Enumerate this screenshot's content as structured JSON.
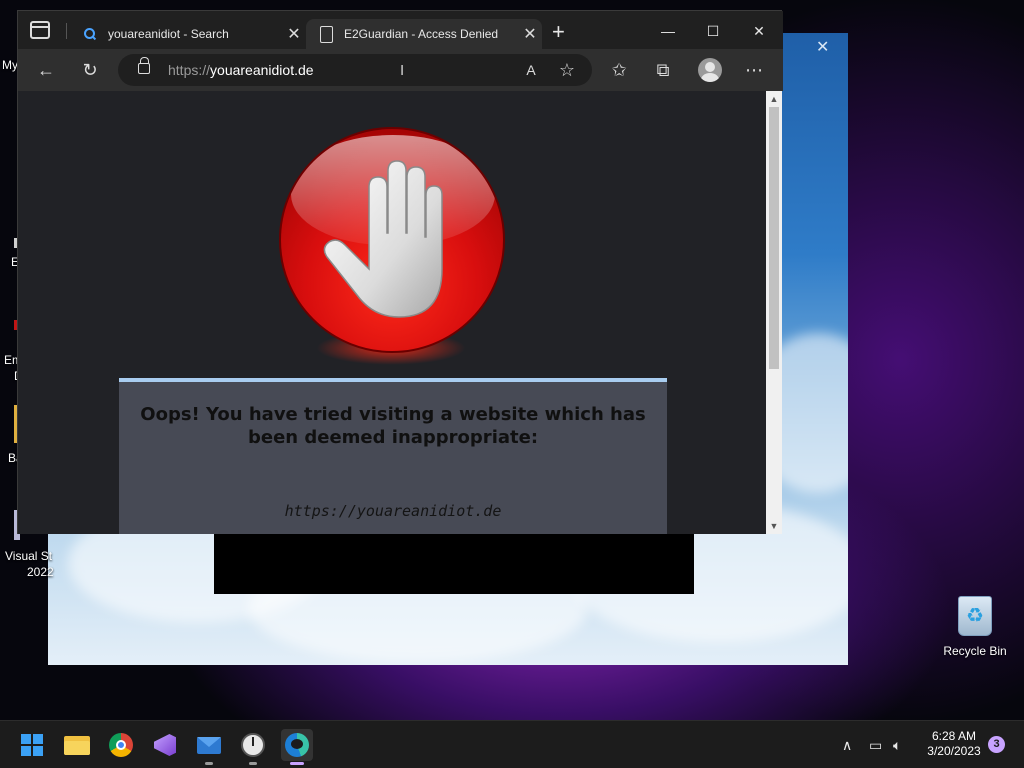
{
  "desktop": {
    "icon_fragments": [
      "My",
      "E",
      "Em",
      "D",
      "Ba",
      "Visual St",
      "2022"
    ],
    "recycle_bin_label": "Recycle Bin",
    "background_close": "✕"
  },
  "browser": {
    "tabs": [
      {
        "title": "youareanidiot - Search",
        "icon": "search-icon",
        "active": false
      },
      {
        "title": "E2Guardian - Access Denied",
        "icon": "page-icon",
        "active": true
      }
    ],
    "new_tab": "+",
    "window_controls": {
      "minimize": "—",
      "maximize": "☐",
      "close": "✕"
    },
    "address": {
      "scheme": "https://",
      "host": "youareanidiot.de"
    },
    "toolbar_icons": [
      "back-arrow-icon",
      "refresh-icon",
      "read-aloud-icon",
      "add-favorite-icon",
      "favorites-icon",
      "collections-icon",
      "profile-icon",
      "more-icon"
    ]
  },
  "page": {
    "headline": "Oops! You have tried visiting a website which has been deemed inappropriate:",
    "blocked_url": "https://youareanidiot.de",
    "accent_color": "#a9cdf0",
    "stop_color": "#e01010"
  },
  "taskbar": {
    "apps": [
      "start-icon",
      "file-explorer-icon",
      "chrome-icon",
      "visual-studio-icon",
      "mail-icon",
      "clock-app-icon",
      "edge-icon"
    ],
    "time": "6:28 AM",
    "date": "3/20/2023",
    "notification_count": "3"
  }
}
